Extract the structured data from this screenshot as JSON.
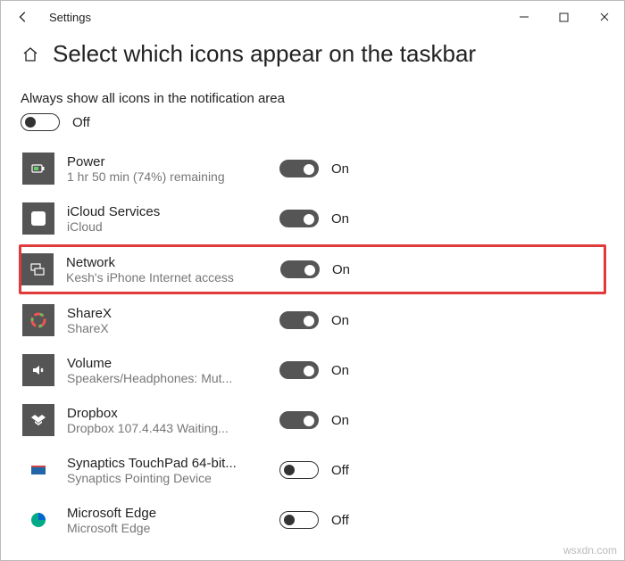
{
  "titlebar": {
    "title": "Settings"
  },
  "heading": "Select which icons appear on the taskbar",
  "master": {
    "label": "Always show all icons in the notification area",
    "state": "Off",
    "on": false
  },
  "items": [
    {
      "title": "Power",
      "sub": "1 hr 50 min (74%) remaining",
      "on": true,
      "state": "On",
      "icon": "power",
      "highlight": false
    },
    {
      "title": "iCloud Services",
      "sub": "iCloud",
      "on": true,
      "state": "On",
      "icon": "icloud",
      "highlight": false
    },
    {
      "title": "Network",
      "sub": "Kesh's iPhone Internet access",
      "on": true,
      "state": "On",
      "icon": "network",
      "highlight": true
    },
    {
      "title": "ShareX",
      "sub": "ShareX",
      "on": true,
      "state": "On",
      "icon": "sharex",
      "highlight": false
    },
    {
      "title": "Volume",
      "sub": "Speakers/Headphones: Mut...",
      "on": true,
      "state": "On",
      "icon": "volume",
      "highlight": false
    },
    {
      "title": "Dropbox",
      "sub": "Dropbox 107.4.443 Waiting...",
      "on": true,
      "state": "On",
      "icon": "dropbox",
      "highlight": false
    },
    {
      "title": "Synaptics TouchPad 64-bit...",
      "sub": "Synaptics Pointing Device",
      "on": false,
      "state": "Off",
      "icon": "synaptics",
      "highlight": false
    },
    {
      "title": "Microsoft Edge",
      "sub": "Microsoft Edge",
      "on": false,
      "state": "Off",
      "icon": "edge",
      "highlight": false
    }
  ],
  "watermark": "wsxdn.com"
}
